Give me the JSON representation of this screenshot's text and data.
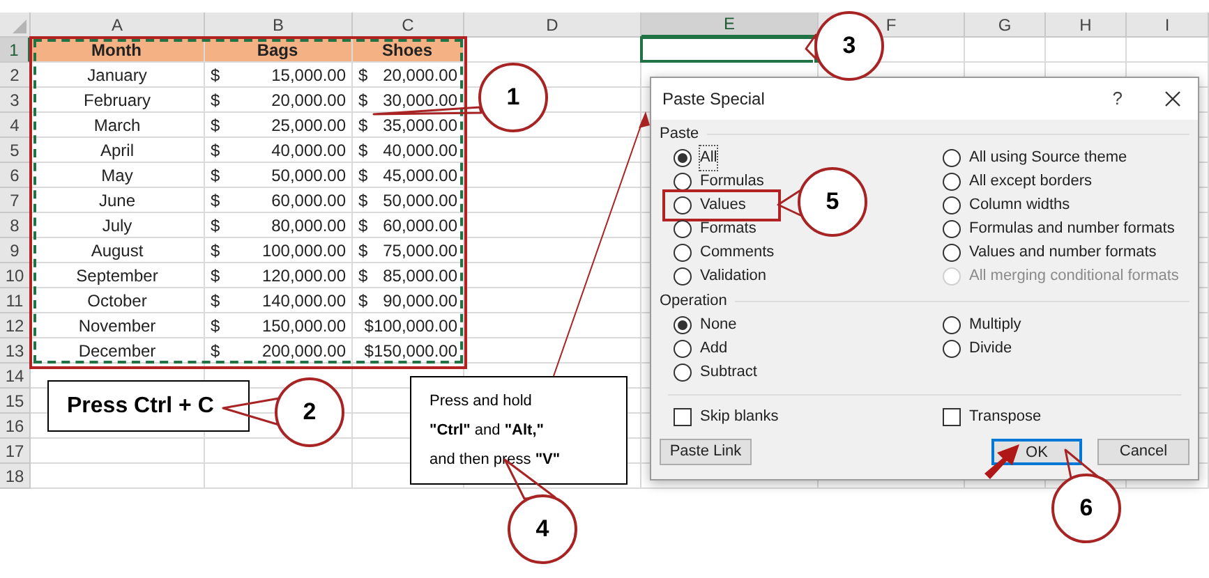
{
  "sheet": {
    "columns": [
      {
        "label": "A",
        "selected": false
      },
      {
        "label": "B",
        "selected": false
      },
      {
        "label": "C",
        "selected": false
      },
      {
        "label": "D",
        "selected": false
      },
      {
        "label": "E",
        "selected": true
      },
      {
        "label": "F",
        "selected": false
      },
      {
        "label": "G",
        "selected": false
      },
      {
        "label": "H",
        "selected": false
      },
      {
        "label": "I",
        "selected": false
      }
    ],
    "rows": [
      {
        "label": "1",
        "selected": true
      },
      {
        "label": "2",
        "selected": false
      },
      {
        "label": "3",
        "selected": false
      },
      {
        "label": "4",
        "selected": false
      },
      {
        "label": "5",
        "selected": false
      },
      {
        "label": "6",
        "selected": false
      },
      {
        "label": "7",
        "selected": false
      },
      {
        "label": "8",
        "selected": false
      },
      {
        "label": "9",
        "selected": false
      },
      {
        "label": "10",
        "selected": false
      },
      {
        "label": "11",
        "selected": false
      },
      {
        "label": "12",
        "selected": false
      },
      {
        "label": "13",
        "selected": false
      },
      {
        "label": "14",
        "selected": false
      },
      {
        "label": "15",
        "selected": false
      },
      {
        "label": "16",
        "selected": false
      },
      {
        "label": "17",
        "selected": false
      },
      {
        "label": "18",
        "selected": false
      }
    ]
  },
  "table": {
    "highlighted": true,
    "copied": true,
    "header": [
      "Month",
      "Bags",
      "Shoes"
    ],
    "rows": [
      {
        "month": "January",
        "bags_symbol": "$",
        "bags": "15,000.00",
        "shoes_symbol": "$",
        "shoes": "20,000.00"
      },
      {
        "month": "February",
        "bags_symbol": "$",
        "bags": "20,000.00",
        "shoes_symbol": "$",
        "shoes": "30,000.00"
      },
      {
        "month": "March",
        "bags_symbol": "$",
        "bags": "25,000.00",
        "shoes_symbol": "$",
        "shoes": "35,000.00"
      },
      {
        "month": "April",
        "bags_symbol": "$",
        "bags": "40,000.00",
        "shoes_symbol": "$",
        "shoes": "40,000.00"
      },
      {
        "month": "May",
        "bags_symbol": "$",
        "bags": "50,000.00",
        "shoes_symbol": "$",
        "shoes": "45,000.00"
      },
      {
        "month": "June",
        "bags_symbol": "$",
        "bags": "60,000.00",
        "shoes_symbol": "$",
        "shoes": "50,000.00"
      },
      {
        "month": "July",
        "bags_symbol": "$",
        "bags": "80,000.00",
        "shoes_symbol": "$",
        "shoes": "60,000.00"
      },
      {
        "month": "August",
        "bags_symbol": "$",
        "bags": "100,000.00",
        "shoes_symbol": "$",
        "shoes": "75,000.00"
      },
      {
        "month": "September",
        "bags_symbol": "$",
        "bags": "120,000.00",
        "shoes_symbol": "$",
        "shoes": "85,000.00"
      },
      {
        "month": "October",
        "bags_symbol": "$",
        "bags": "140,000.00",
        "shoes_symbol": "$",
        "shoes": "90,000.00"
      },
      {
        "month": "November",
        "bags_symbol": "$",
        "bags": "150,000.00",
        "shoes_symbol": "$",
        "shoes": "100,000.00"
      },
      {
        "month": "December",
        "bags_symbol": "$",
        "bags": "200,000.00",
        "shoes_symbol": "$",
        "shoes": "150,000.00"
      }
    ]
  },
  "copy_note": {
    "text": "Press Ctrl + C"
  },
  "shortcut_note": {
    "lines": [
      "Press and hold",
      "**\"Ctrl\"** and **\"Alt,\"**",
      "and then press **\"V\"**"
    ]
  },
  "callouts": [
    {
      "number": "1"
    },
    {
      "number": "2"
    },
    {
      "number": "3"
    },
    {
      "number": "4"
    },
    {
      "number": "5"
    },
    {
      "number": "6"
    }
  ],
  "dialog": {
    "title": "Paste Special",
    "help": "?",
    "paste_label": "Paste",
    "paste_columns": [
      [
        {
          "label": "All",
          "selected": true,
          "disabled": false,
          "highlighted": false
        },
        {
          "label": "Formulas",
          "selected": false,
          "disabled": false,
          "highlighted": false
        },
        {
          "label": "Values",
          "selected": false,
          "disabled": false,
          "highlighted": true
        },
        {
          "label": "Formats",
          "selected": false,
          "disabled": false,
          "highlighted": false
        },
        {
          "label": "Comments",
          "selected": false,
          "disabled": false,
          "highlighted": false
        },
        {
          "label": "Validation",
          "selected": false,
          "disabled": false,
          "highlighted": false
        }
      ],
      [
        {
          "label": "All using Source theme",
          "selected": false,
          "disabled": false,
          "highlighted": false
        },
        {
          "label": "All except borders",
          "selected": false,
          "disabled": false,
          "highlighted": false
        },
        {
          "label": "Column widths",
          "selected": false,
          "disabled": false,
          "highlighted": false
        },
        {
          "label": "Formulas and number formats",
          "selected": false,
          "disabled": false,
          "highlighted": false
        },
        {
          "label": "Values and number formats",
          "selected": false,
          "disabled": false,
          "highlighted": false
        },
        {
          "label": "All merging conditional formats",
          "selected": false,
          "disabled": true,
          "highlighted": false
        }
      ]
    ],
    "operation_label": "Operation",
    "operation_columns": [
      [
        {
          "label": "None",
          "selected": true
        },
        {
          "label": "Add",
          "selected": false
        },
        {
          "label": "Subtract",
          "selected": false
        }
      ],
      [
        {
          "label": "Multiply",
          "selected": false
        },
        {
          "label": "Divide",
          "selected": false
        }
      ]
    ],
    "checkboxes": [
      {
        "label": "Skip blanks",
        "checked": false
      },
      {
        "label": "Transpose",
        "checked": false
      }
    ],
    "buttons": [
      {
        "label": "Paste Link",
        "default": false
      },
      {
        "label": "OK",
        "default": true
      },
      {
        "label": "Cancel",
        "default": false
      }
    ]
  }
}
